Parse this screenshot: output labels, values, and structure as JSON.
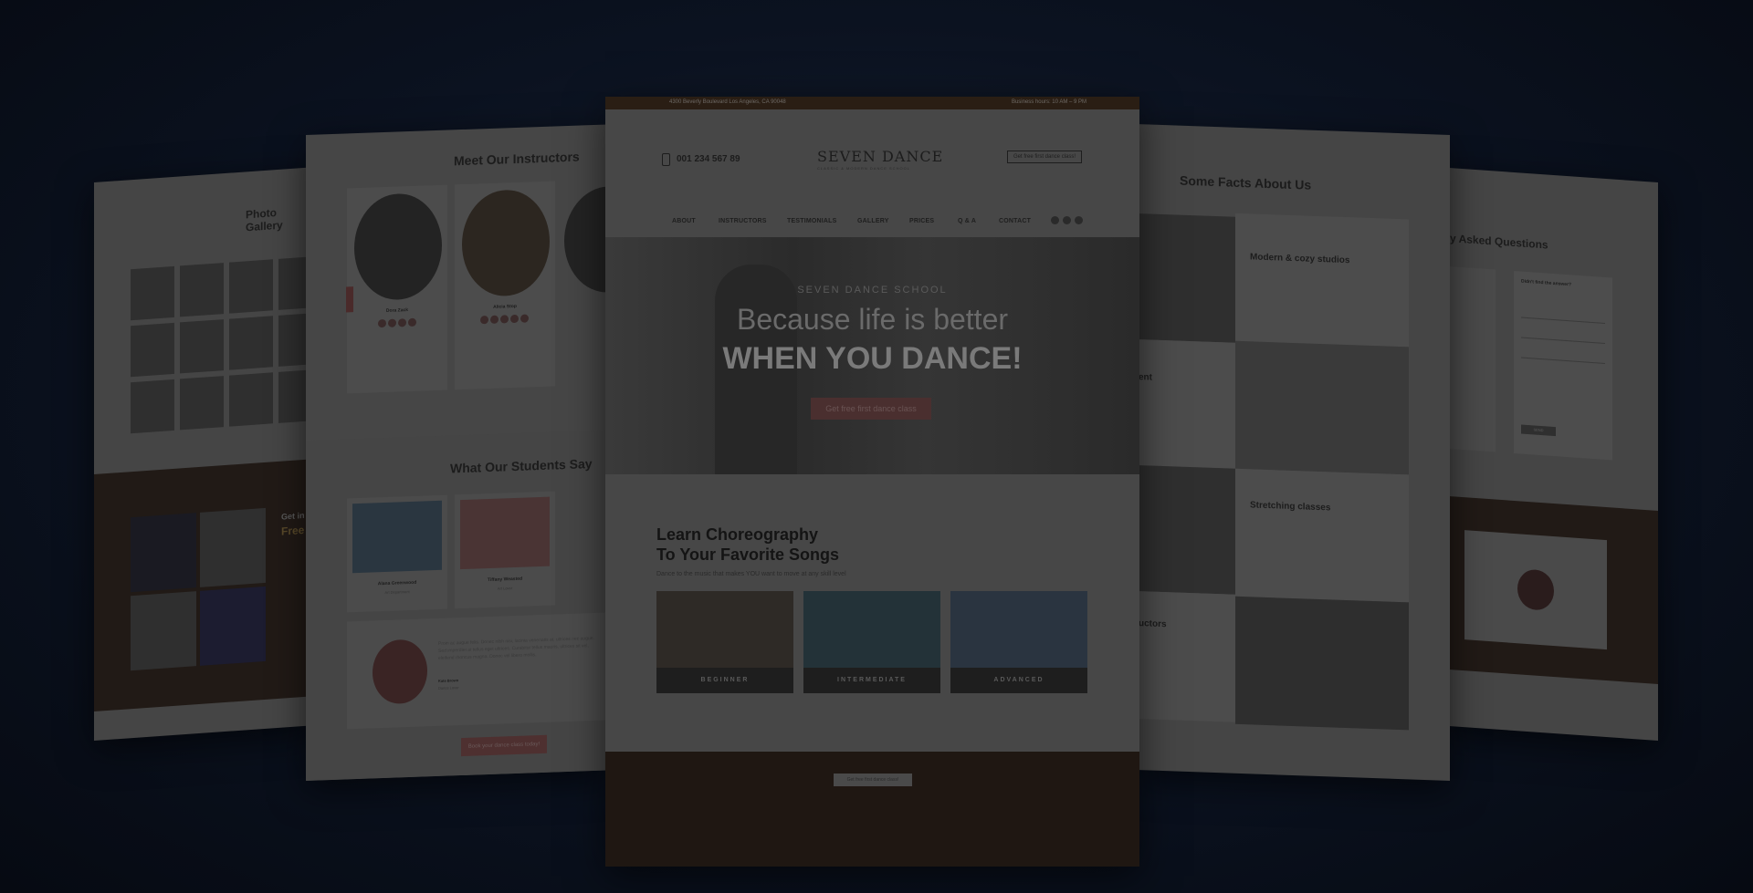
{
  "far_left": {
    "title": "Photo Gallery",
    "side_text_1": "Get in",
    "side_text_2": "Free"
  },
  "left": {
    "instructors_title": "Meet Our Instructors",
    "instructors": [
      {
        "name": "Dora Zack"
      },
      {
        "name": "Alicia Stop"
      },
      {
        "name": ""
      }
    ],
    "students_title": "What Our Students Say",
    "students": [
      {
        "name": "Alana Greenwood",
        "role": "Art Department"
      },
      {
        "name": "Tiffany Weasted",
        "role": "Art Lover"
      }
    ],
    "quote_text": "Proin ac augue felis. Donec nibh nisi, lacinia venenatis at, ultrices nec augue. Sed imperdiet at tellus eget ultrices. Curabitur tellus mauris, ultrices sit vel, eleifend rhoncus magna. Donec vel libero mollis.",
    "quote_author": "Kate Brown",
    "quote_role": "Dance Lover",
    "cta": "Book your dance class today!"
  },
  "main": {
    "address": "4300 Beverly Boulevard Los Angeles, CA 90048",
    "hours": "Business hours: 10 AM – 9 PM",
    "phone": "001 234 567 89",
    "logo": "SEVEN DANCE",
    "logo_sub": "CLASSIC & MODERN DANCE SCHOOL",
    "header_cta": "Get free first dance class!",
    "nav": [
      "ABOUT",
      "INSTRUCTORS",
      "TESTIMONIALS",
      "GALLERY",
      "PRICES",
      "Q & A",
      "CONTACT"
    ],
    "hero_kicker": "SEVEN DANCE SCHOOL",
    "hero_line1": "Because life is better",
    "hero_line2": "WHEN YOU DANCE!",
    "hero_cta": "Get free first dance class",
    "learn_title1": "Learn Choreography",
    "learn_title2": "To Your Favorite Songs",
    "learn_sub": "Dance to the music that makes YOU want to move at any skill level",
    "levels": [
      "BEGINNER",
      "INTERMEDIATE",
      "ADVANCED"
    ],
    "footer_cta": "Get free first dance class!"
  },
  "right": {
    "facts_title": "Some Facts About Us",
    "facts": [
      {
        "title": "Modern & cozy studios"
      },
      {
        "title": "ent"
      },
      {
        "title": "Stretching classes"
      },
      {
        "title": "uctors"
      }
    ]
  },
  "far_right": {
    "faq_title": "y Asked Questions",
    "form_title": "Didn't find the answer?",
    "form_button": "SEND"
  },
  "colors": {
    "accent": "#5a3a3a",
    "background": "#0b1220",
    "footer": "#1f1712"
  }
}
